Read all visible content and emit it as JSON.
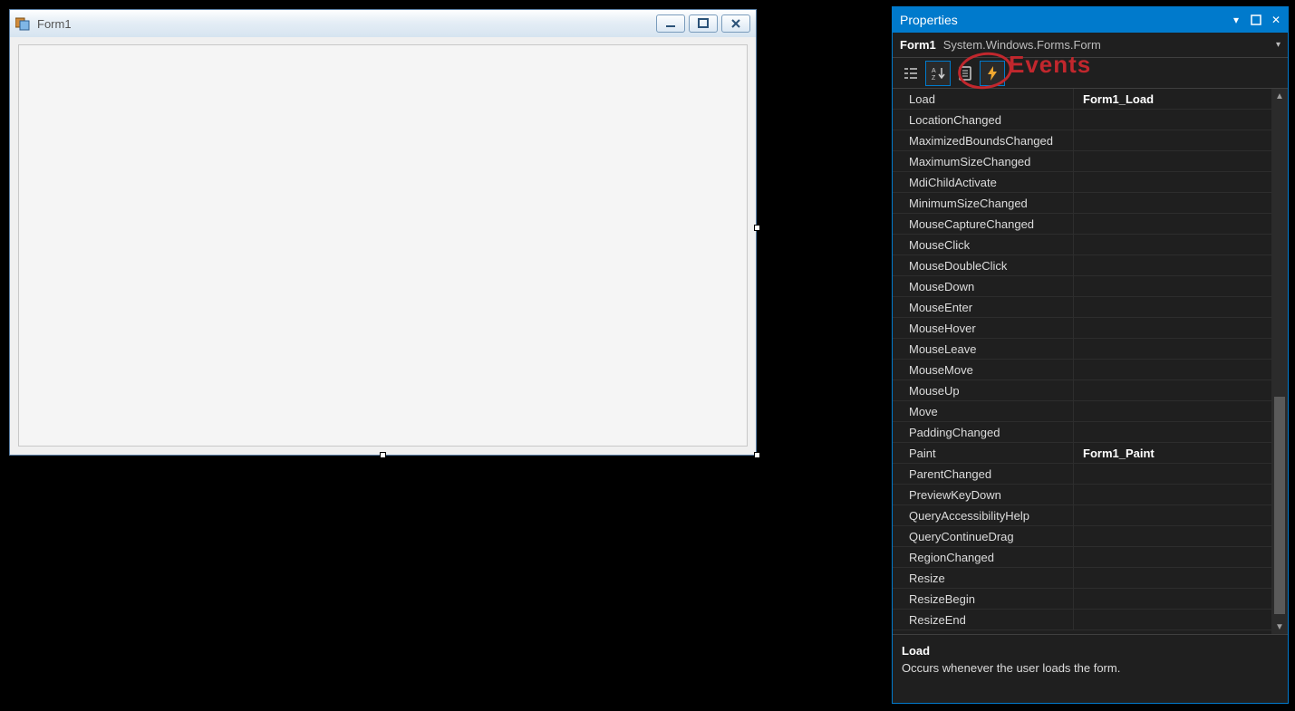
{
  "form": {
    "title": "Form1",
    "buttons": {
      "min": "—",
      "max": "❐",
      "close": "✕"
    }
  },
  "panel": {
    "title": "Properties",
    "object": {
      "name": "Form1",
      "type": "System.Windows.Forms.Form"
    },
    "annotation": "Events",
    "events": [
      {
        "name": "Load",
        "value": "Form1_Load"
      },
      {
        "name": "LocationChanged",
        "value": ""
      },
      {
        "name": "MaximizedBoundsChanged",
        "value": ""
      },
      {
        "name": "MaximumSizeChanged",
        "value": ""
      },
      {
        "name": "MdiChildActivate",
        "value": ""
      },
      {
        "name": "MinimumSizeChanged",
        "value": ""
      },
      {
        "name": "MouseCaptureChanged",
        "value": ""
      },
      {
        "name": "MouseClick",
        "value": ""
      },
      {
        "name": "MouseDoubleClick",
        "value": ""
      },
      {
        "name": "MouseDown",
        "value": ""
      },
      {
        "name": "MouseEnter",
        "value": ""
      },
      {
        "name": "MouseHover",
        "value": ""
      },
      {
        "name": "MouseLeave",
        "value": ""
      },
      {
        "name": "MouseMove",
        "value": ""
      },
      {
        "name": "MouseUp",
        "value": ""
      },
      {
        "name": "Move",
        "value": ""
      },
      {
        "name": "PaddingChanged",
        "value": ""
      },
      {
        "name": "Paint",
        "value": "Form1_Paint"
      },
      {
        "name": "ParentChanged",
        "value": ""
      },
      {
        "name": "PreviewKeyDown",
        "value": ""
      },
      {
        "name": "QueryAccessibilityHelp",
        "value": ""
      },
      {
        "name": "QueryContinueDrag",
        "value": ""
      },
      {
        "name": "RegionChanged",
        "value": ""
      },
      {
        "name": "Resize",
        "value": ""
      },
      {
        "name": "ResizeBegin",
        "value": ""
      },
      {
        "name": "ResizeEnd",
        "value": ""
      }
    ],
    "description": {
      "name": "Load",
      "text": "Occurs whenever the user loads the form."
    }
  }
}
